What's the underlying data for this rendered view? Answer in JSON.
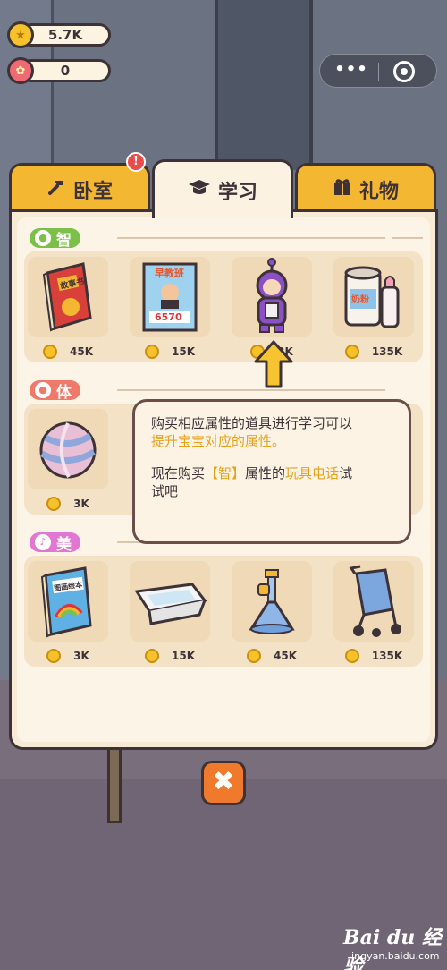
{
  "hud": {
    "coins": "5.7K",
    "flowers": "0",
    "coin_icon": "coin-icon",
    "flower_icon": "flower-icon"
  },
  "capsule": {
    "more": "•••"
  },
  "tabs": [
    {
      "label": "卧室",
      "icon": "hammer-icon",
      "badge": "!"
    },
    {
      "label": "学习",
      "icon": "graduation-cap-icon"
    },
    {
      "label": "礼物",
      "icon": "gift-icon"
    }
  ],
  "sections": [
    {
      "label": "智",
      "color": "#7cc04a",
      "icon": "lightbulb-icon",
      "items": [
        {
          "name": "故事书",
          "price": "45K"
        },
        {
          "name": "早教班",
          "price": "15K",
          "poster_number": "6570"
        },
        {
          "name": "玩具电话",
          "price": "3K"
        },
        {
          "name": "奶粉",
          "price": "135K"
        }
      ]
    },
    {
      "label": "体",
      "color": "#f07a6a",
      "icon": "basketball-icon",
      "items": [
        {
          "name": "球",
          "price": "3K"
        }
      ]
    },
    {
      "label": "美",
      "color": "#e277d2",
      "icon": "music-note-icon",
      "items": [
        {
          "name": "图画绘本",
          "price": "3K"
        },
        {
          "name": "浴盆",
          "price": "15K"
        },
        {
          "name": "喇叭",
          "price": "45K"
        },
        {
          "name": "婴儿车",
          "price": "135K"
        }
      ]
    }
  ],
  "tooltip": {
    "line1": "购买相应属性的道具进行学习可以",
    "line2": "提升宝宝对应的属性。",
    "line3_a": "现在购买",
    "line3_b": "【智】",
    "line3_c": "属性的",
    "line3_d": "玩具电话",
    "line3_e": "试",
    "line4": "试吧"
  },
  "close_label": "✖",
  "watermark": {
    "brand": "Bai du 经验",
    "url": "jingyan.baidu.com"
  }
}
